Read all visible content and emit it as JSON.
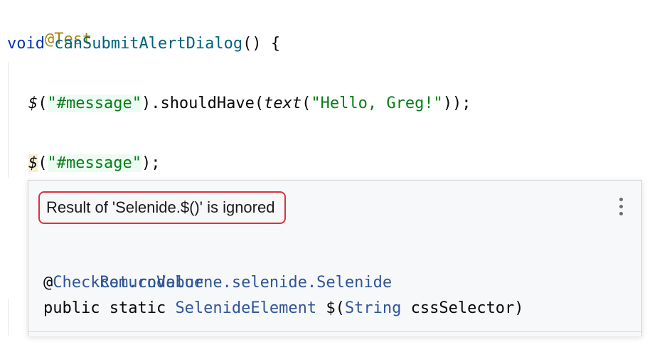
{
  "editor": {
    "lines": {
      "l1_annotation": "@Test",
      "l2_keyword": "void",
      "l2_method": "canSubmitAlertDialog",
      "l2_rest": "() {",
      "l3_func": "$",
      "l3_p1": "(",
      "l3_str": "\"#message\"",
      "l3_p2": ").shouldHave(",
      "l3_text_fn": "text",
      "l3_p3": "(",
      "l3_str2": "\"Hello, Greg!\"",
      "l3_p4": "));",
      "l4_func": "$",
      "l4_p1": "(",
      "l4_str": "\"#message\"",
      "l4_p2": ");",
      "l5_brace": "}",
      "l6_annotation_partial": "@T",
      "l7_keyword_partial": "vo"
    }
  },
  "popup": {
    "warning_text": "Result of 'Selenide.$()' is ignored",
    "menu_icon": "more-vertical-icon",
    "doc": {
      "package": "com.codeborne.selenide.Selenide",
      "annotation_at": "@",
      "annotation_name": "CheckReturnValue",
      "sig_mod": "public static ",
      "sig_return_type": "SelenideElement",
      "sig_name": " $(",
      "sig_param_type": "String",
      "sig_param_name": " cssSelector)"
    }
  },
  "colors": {
    "keyword": "#0033b3",
    "method": "#00627a",
    "string": "#067d17",
    "annotation": "#9e880d",
    "warning_outline": "#e0303a"
  }
}
